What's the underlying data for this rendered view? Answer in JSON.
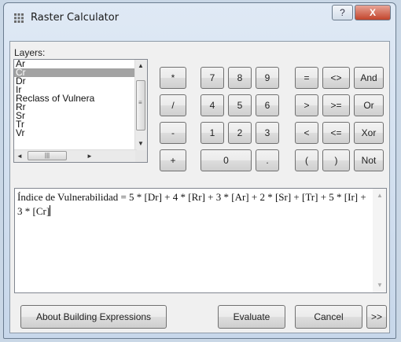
{
  "window": {
    "title": "Raster Calculator",
    "help_label": "?",
    "close_label": "X"
  },
  "layers": {
    "label": "Layers:",
    "items": [
      {
        "label": "Ar",
        "selected": false
      },
      {
        "label": "Cr",
        "selected": true
      },
      {
        "label": "Dr",
        "selected": false
      },
      {
        "label": "Ir",
        "selected": false
      },
      {
        "label": "Reclass of Vulnera",
        "selected": false
      },
      {
        "label": "Rr",
        "selected": false
      },
      {
        "label": "Sr",
        "selected": false
      },
      {
        "label": "Tr",
        "selected": false
      },
      {
        "label": "Vr",
        "selected": false
      }
    ],
    "scroll_up": "▲",
    "scroll_down": "▼",
    "scroll_left": "◄",
    "scroll_right": "►",
    "hthumb_grip": "|||"
  },
  "keypad": {
    "multiply": "*",
    "divide": "/",
    "minus": "-",
    "plus": "+",
    "seven": "7",
    "eight": "8",
    "nine": "9",
    "four": "4",
    "five": "5",
    "six": "6",
    "one": "1",
    "two": "2",
    "three": "3",
    "zero": "0",
    "decimal": ".",
    "equal": "=",
    "not_equal": "<>",
    "and": "And",
    "greater": ">",
    "greater_equal": ">=",
    "or": "Or",
    "less": "<",
    "less_equal": "<=",
    "xor": "Xor",
    "open_paren": "(",
    "close_paren": ")",
    "not": "Not"
  },
  "expression": {
    "text": "Índice de Vulnerabilidad = 5 * [Dr] + 4 * [Rr] + 3 * [Ar] + 2 * [Sr] + [Tr] + 5 * [Ir] + 3 * [Cr]"
  },
  "footer": {
    "about_label": "About Building Expressions",
    "evaluate_label": "Evaluate",
    "cancel_label": "Cancel",
    "more_label": ">>"
  },
  "colors": {
    "selection": "#a3a3a3",
    "close_button": "#c2452c",
    "title_bar": "#dfe9f5"
  }
}
